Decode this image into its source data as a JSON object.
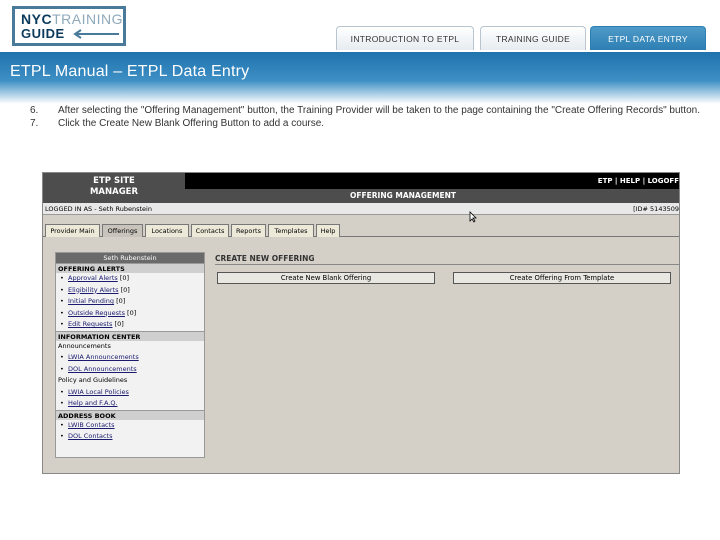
{
  "logo": {
    "word_nyc": "NYC",
    "word_training": "TRAINING",
    "word_guide": "GUIDE"
  },
  "tabs": [
    {
      "label": "INTRODUCTION TO ETPL"
    },
    {
      "label": "TRAINING GUIDE"
    },
    {
      "label": "ETPL DATA ENTRY",
      "active": true
    }
  ],
  "page_title": "ETPL Manual – ETPL Data Entry",
  "steps": [
    {
      "num": "6.",
      "text": "After selecting the \"Offering Management\" button, the Training Provider will be taken to the page containing the \"Create Offering Records\" button."
    },
    {
      "num": "7.",
      "text": "Click the Create New Blank Offering Button to add a course."
    }
  ],
  "screenshot": {
    "site_title_line1": "ETP SITE",
    "site_title_line2": "MANAGER",
    "section_title": "OFFERING MANAGEMENT",
    "top_links": "ETP | HELP | LOGOFF",
    "logged_in": "LOGGED IN AS - Seth Rubenstein",
    "id_label": "[ID# 5143509",
    "nav_tabs": [
      "Provider Main",
      "Offerings",
      "Locations",
      "Contacts",
      "Reports",
      "Templates",
      "Help"
    ],
    "user_name": "Seth Rubenstein",
    "offering_alerts": {
      "title": "OFFERING ALERTS",
      "items": [
        {
          "label": "Approval Alerts",
          "count": "[0]"
        },
        {
          "label": "Eligibility Alerts",
          "count": "[0]"
        },
        {
          "label": "Initial Pending",
          "count": "[0]"
        },
        {
          "label": "Outside Requests",
          "count": "[0]"
        },
        {
          "label": "Edit Requests",
          "count": "[0]"
        }
      ]
    },
    "information_center": {
      "title": "INFORMATION CENTER",
      "sub1": "Announcements",
      "items1": [
        "LWIA Announcements",
        "DOL Announcements"
      ],
      "sub2": "Policy and Guidelines",
      "items2": [
        "LWIA Local Policies",
        "Help and F.A.Q."
      ]
    },
    "address_book": {
      "title": "ADDRESS BOOK",
      "items": [
        "LWIB Contacts",
        "DOL Contacts"
      ]
    },
    "create_heading": "CREATE NEW OFFERING",
    "btn_blank": "Create New Blank Offering",
    "btn_template": "Create Offering From Template"
  },
  "colors": {
    "accent": "#2d7fb3",
    "logo_border": "#4a7a9a",
    "logo_text": "#0b3b5c"
  }
}
